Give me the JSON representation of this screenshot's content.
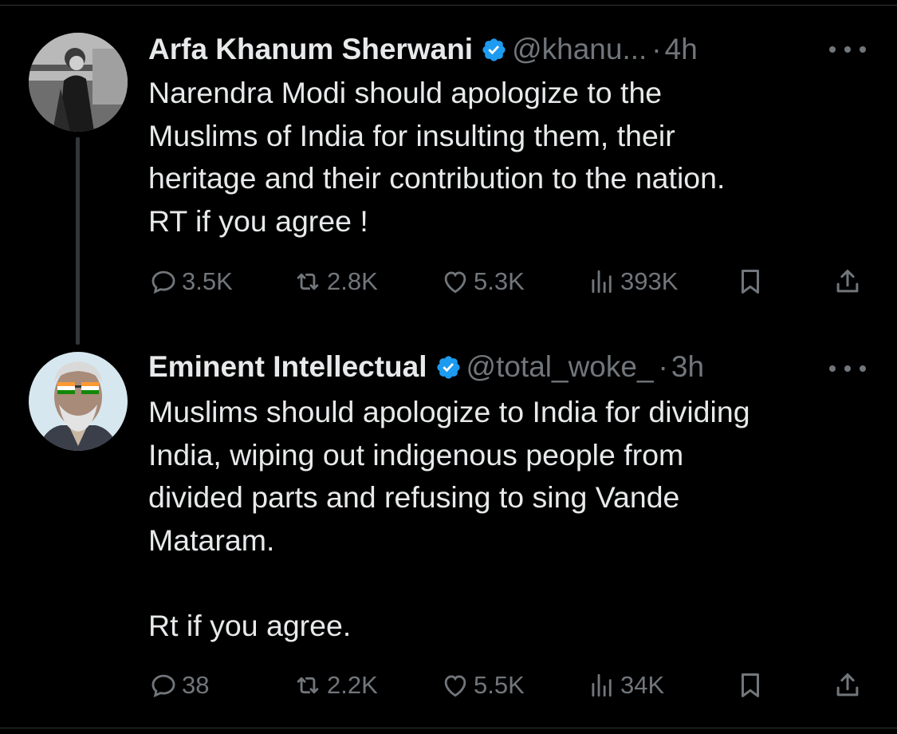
{
  "tweets": [
    {
      "name": "Arfa Khanum Sherwani",
      "handle": "@khanu...",
      "separator": "·",
      "time": "4h",
      "text": "Narendra Modi should apologize to the\nMuslims of India for insulting them, their\nheritage and their contribution to the nation.\nRT if you agree !",
      "replies": "3.5K",
      "reposts": "2.8K",
      "likes": "5.3K",
      "views": "393K"
    },
    {
      "name": "Eminent Intellectual",
      "handle": "@total_woke_",
      "separator": "·",
      "time": "3h",
      "text": "Muslims should apologize to India for dividing\nIndia, wiping out indigenous people from\ndivided parts and refusing to sing Vande\nMataram.\n\nRt if you agree.",
      "replies": "38",
      "reposts": "2.2K",
      "likes": "5.5K",
      "views": "34K"
    }
  ],
  "icons": {
    "verified": "verified-badge-icon",
    "reply": "reply-icon",
    "repost": "repost-icon",
    "like": "like-icon",
    "views": "views-icon",
    "bookmark": "bookmark-icon",
    "share": "share-icon",
    "more": "more-icon"
  },
  "colors": {
    "background": "#000000",
    "text": "#e7e9ea",
    "secondary": "#71767b",
    "verified": "#1d9bf0"
  }
}
